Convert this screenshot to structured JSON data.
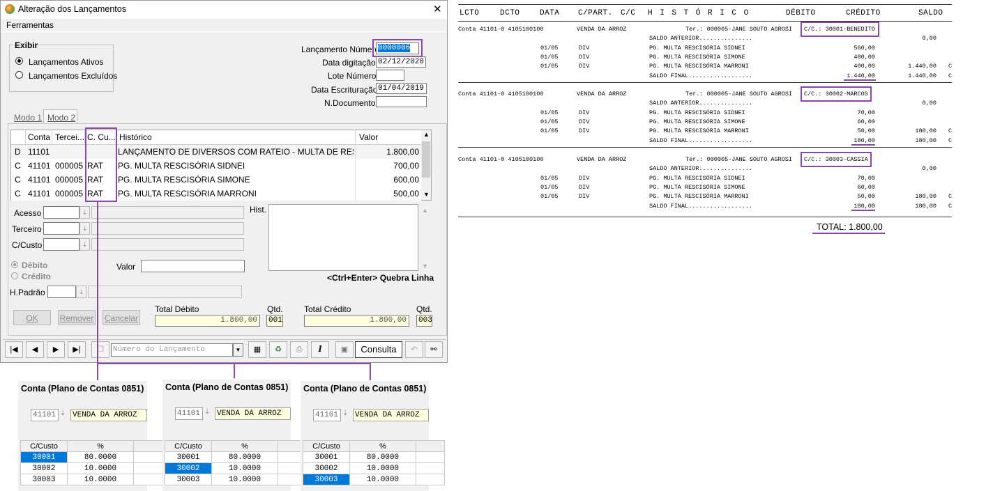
{
  "dialog": {
    "title": "Alteração dos Lançamentos",
    "menu": "Ferramentas",
    "close_symbol": "✕",
    "exibir": {
      "label": "Exibir",
      "options": [
        "Lançamentos Ativos",
        "Lançamentos Excluídos"
      ],
      "selected": 0
    },
    "fields": {
      "lancamento_numero_label": "Lançamento Número",
      "lancamento_numero": "0000006",
      "data_digitacao_label": "Data digitação",
      "data_digitacao": "02/12/2020",
      "lote_numero_label": "Lote Número",
      "lote_numero": "",
      "data_escrituracao_label": "Data Escrituração",
      "data_escrituracao": "01/04/2019",
      "n_documento_label": "N.Documento",
      "n_documento": ""
    },
    "tabs": [
      "Modo 1",
      "Modo 2"
    ],
    "grid": {
      "headers": [
        "",
        "Conta",
        "Tercei...",
        "C. Cu...",
        "Histórico",
        "Valor"
      ],
      "rows": [
        [
          "D",
          "11101",
          "",
          "",
          "LANÇAMENTO DE DIVERSOS COM RATEIO - MULTA DE RESCIS...",
          "1.800,00"
        ],
        [
          "C",
          "41101",
          "000005",
          "RAT",
          "PG. MULTA RESCISÓRIA SIDNEI",
          "700,00"
        ],
        [
          "C",
          "41101",
          "000005",
          "RAT",
          "PG. MULTA RESCISÓRIA SIMONE",
          "600,00"
        ],
        [
          "C",
          "41101",
          "000005",
          "RAT",
          "PG. MULTA RESCISÓRIA MARRONI",
          "500,00"
        ]
      ]
    },
    "form": {
      "acesso": "Acesso",
      "terceiro": "Terceiro",
      "ccusto": "C/Custo",
      "hist": "Hist.",
      "debito": "Débito",
      "credito": "Crédito",
      "valor": "Valor",
      "hpadrao": "H.Padrão",
      "quebra": "<Ctrl+Enter> Quebra Linha"
    },
    "buttons": {
      "ok": "OK",
      "remover": "Remover",
      "cancelar": "Cancelar"
    },
    "totals": {
      "debito_label": "Total Débito",
      "debito": "1.800,00",
      "qtd_label": "Qtd.",
      "qtd_debito": "001",
      "credito_label": "Total Crédito",
      "credito": "1.800,00",
      "qtd_credito": "003"
    },
    "toolbar": {
      "search_placeholder": "Número do Lançamento",
      "mode": "Consulta"
    }
  },
  "report": {
    "headers": [
      "LCTO",
      "DCTO",
      "DATA",
      "C/PART.",
      "C/C",
      "H I S T Ó R I C O",
      "DÉBITO",
      "CRÉDITO",
      "SALDO"
    ],
    "blocks": [
      {
        "conta": "Conta  41101-0  4105100100",
        "descricao": "VENDA DA ARROZ",
        "ter": "Ter.:  000005-JANE SOUTO AGROSI",
        "cc": "C/C.:  30001-BENEDITO",
        "saldo_anterior": "SALDO ANTERIOR...............",
        "saldo_anterior_val": "0,00",
        "lines": [
          {
            "data": "01/05",
            "cpart": "DIV",
            "hist": "PG. MULTA RESCISÓRIA SIDNEI",
            "credito": "560,00",
            "saldo": "",
            "dc": ""
          },
          {
            "data": "01/05",
            "cpart": "DIV",
            "hist": "PG. MULTA RESCISÓRIA SIMONE",
            "credito": "480,00",
            "saldo": "",
            "dc": ""
          },
          {
            "data": "01/05",
            "cpart": "DIV",
            "hist": "PG. MULTA RESCISÓRIA MARRONI",
            "credito": "400,00",
            "saldo": "1.440,00",
            "dc": "C"
          }
        ],
        "saldo_final": "SALDO FINAL..................",
        "saldo_final_credito": "1.440,00",
        "saldo_final_saldo": "1.440,00",
        "saldo_final_dc": "C"
      },
      {
        "conta": "Conta  41101-0  4105100100",
        "descricao": "VENDA DA ARROZ",
        "ter": "Ter.:  000005-JANE SOUTO AGROSI",
        "cc": "C/C.:  30002-MARCOS",
        "saldo_anterior": "SALDO ANTERIOR...............",
        "saldo_anterior_val": "0,00",
        "lines": [
          {
            "data": "01/05",
            "cpart": "DIV",
            "hist": "PG. MULTA RESCISÓRIA SIDNEI",
            "credito": "70,00",
            "saldo": "",
            "dc": ""
          },
          {
            "data": "01/05",
            "cpart": "DIV",
            "hist": "PG. MULTA RESCISÓRIA SIMONE",
            "credito": "60,00",
            "saldo": "",
            "dc": ""
          },
          {
            "data": "01/05",
            "cpart": "DIV",
            "hist": "PG. MULTA RESCISÓRIA MARRONI",
            "credito": "50,00",
            "saldo": "180,00",
            "dc": "C"
          }
        ],
        "saldo_final": "SALDO FINAL..................",
        "saldo_final_credito": "180,00",
        "saldo_final_saldo": "180,00",
        "saldo_final_dc": "C"
      },
      {
        "conta": "Conta  41101-0  4105100100",
        "descricao": "VENDA DA ARROZ",
        "ter": "Ter.:  000005-JANE SOUTO AGROSI",
        "cc": "C/C.:  30003-CASSIA",
        "saldo_anterior": "SALDO ANTERIOR...............",
        "saldo_anterior_val": "0,00",
        "lines": [
          {
            "data": "01/05",
            "cpart": "DIV",
            "hist": "PG. MULTA RESCISÓRIA SIDNEI",
            "credito": "70,00",
            "saldo": "",
            "dc": ""
          },
          {
            "data": "01/05",
            "cpart": "DIV",
            "hist": "PG. MULTA RESCISÓRIA SIMONE",
            "credito": "60,00",
            "saldo": "",
            "dc": ""
          },
          {
            "data": "01/05",
            "cpart": "DIV",
            "hist": "PG. MULTA RESCISÓRIA MARRONI",
            "credito": "50,00",
            "saldo": "180,00",
            "dc": "C"
          }
        ],
        "saldo_final": "SALDO FINAL..................",
        "saldo_final_credito": "180,00",
        "saldo_final_saldo": "180,00",
        "saldo_final_dc": "C"
      }
    ],
    "total": "TOTAL: 1.800,00"
  },
  "panels": [
    {
      "title": "Conta  (Plano de Contas 0851)",
      "conta": "41101",
      "nome": "VENDA DA ARROZ",
      "headers": [
        "C/Custo",
        "%"
      ],
      "rows": [
        [
          "30001",
          "80.0000"
        ],
        [
          "30002",
          "10.0000"
        ],
        [
          "30003",
          "10.0000"
        ]
      ],
      "selected": 0
    },
    {
      "title": "Conta  (Plano de Contas 0851)",
      "conta": "41101",
      "nome": "VENDA DA ARROZ",
      "headers": [
        "C/Custo",
        "%"
      ],
      "rows": [
        [
          "30001",
          "80.0000"
        ],
        [
          "30002",
          "10.0000"
        ],
        [
          "30003",
          "10.0000"
        ]
      ],
      "selected": 1
    },
    {
      "title": "Conta  (Plano de Contas 0851)",
      "conta": "41101",
      "nome": "VENDA DA ARROZ",
      "headers": [
        "C/Custo",
        "%"
      ],
      "rows": [
        [
          "30001",
          "80.0000"
        ],
        [
          "30002",
          "10.0000"
        ],
        [
          "30003",
          "10.0000"
        ]
      ],
      "selected": 2
    }
  ],
  "colors": {
    "accent_purple": "#8e44ad",
    "selection_blue": "#0078d7",
    "readonly_yellow": "#ffffe0"
  }
}
